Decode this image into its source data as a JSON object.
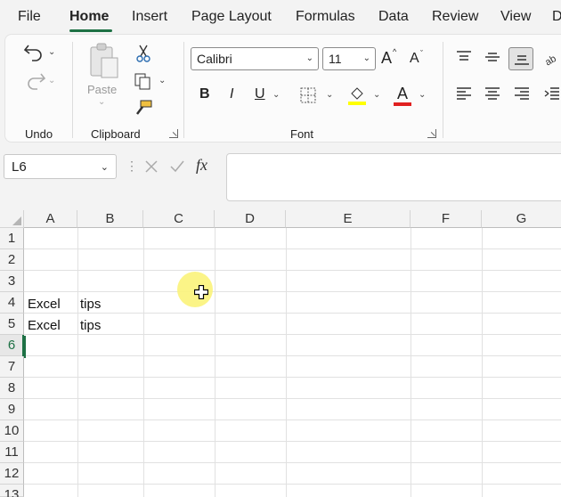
{
  "menu": {
    "tabs": [
      "File",
      "Home",
      "Insert",
      "Page Layout",
      "Formulas",
      "Data",
      "Review",
      "View",
      "D"
    ],
    "active": "Home"
  },
  "ribbon": {
    "groups": {
      "undo": "Undo",
      "clipboard": "Clipboard",
      "font": "Font"
    },
    "paste_label": "Paste",
    "font_name": "Calibri",
    "font_size": "11",
    "bold": "B",
    "italic": "I",
    "underline": "U",
    "grow_font": "A",
    "shrink_font": "A",
    "font_color_letter": "A",
    "highlight_color": "#ffff00",
    "font_color": "#e02020"
  },
  "formula_bar": {
    "name_box": "L6",
    "fx": "fx",
    "formula": ""
  },
  "sheet": {
    "columns": [
      "A",
      "B",
      "C",
      "D",
      "E",
      "F",
      "G"
    ],
    "rows": [
      "1",
      "2",
      "3",
      "4",
      "5",
      "6",
      "7",
      "8",
      "9",
      "10",
      "11",
      "12",
      "13"
    ],
    "cells": {
      "A4": "Excel",
      "B4": "tips",
      "A5": "Excel",
      "B5": "tips"
    },
    "selected_row": "6",
    "accent": "#1e7145"
  }
}
